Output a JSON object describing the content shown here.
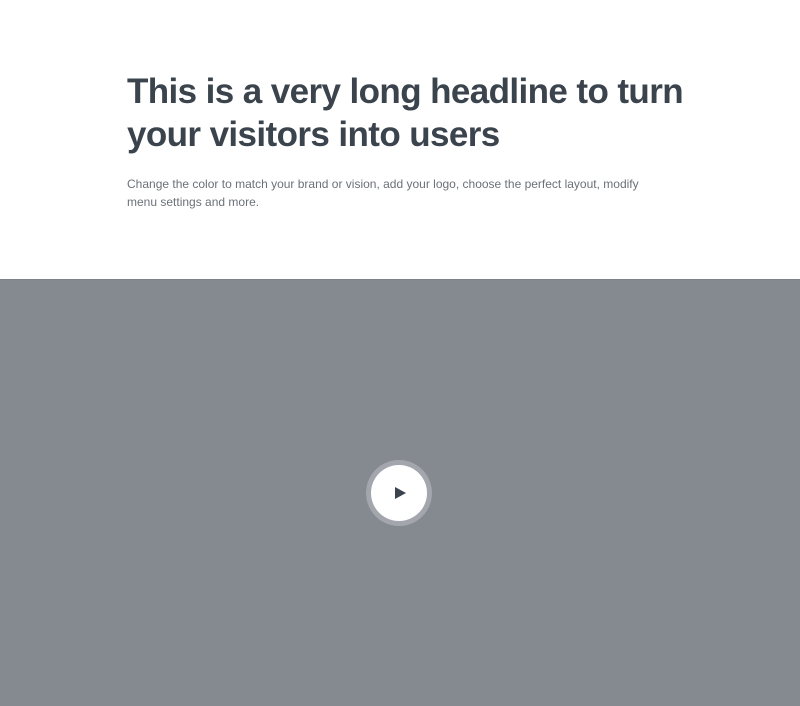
{
  "hero": {
    "headline": "This is a very long headline to turn your visitors into users",
    "subtext": "Change the color to match your brand or vision, add your logo, choose the perfect layout, modify menu settings and more."
  },
  "video": {
    "play_icon": "play-icon",
    "background_color": "#858990"
  },
  "colors": {
    "headline": "#3b444d",
    "subtext": "#6b7178",
    "play_button": "#ffffff"
  }
}
